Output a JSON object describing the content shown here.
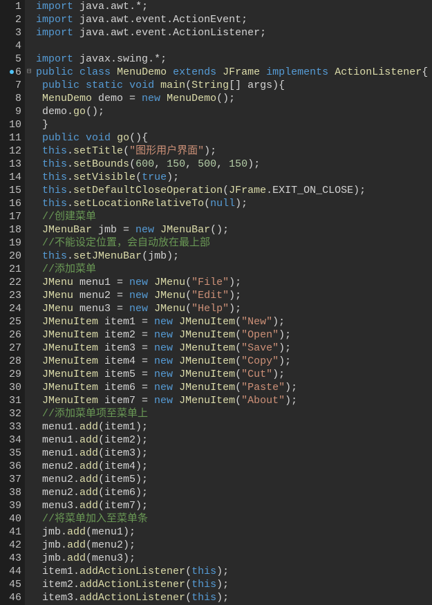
{
  "lines": [
    {
      "n": 1,
      "tokens": [
        [
          "kw",
          "import"
        ],
        [
          "txt",
          " java"
        ],
        [
          "txt",
          "."
        ],
        [
          "txt",
          "awt"
        ],
        [
          "txt",
          ".*;"
        ]
      ]
    },
    {
      "n": 2,
      "tokens": [
        [
          "kw",
          "import"
        ],
        [
          "txt",
          " java"
        ],
        [
          "txt",
          "."
        ],
        [
          "txt",
          "awt"
        ],
        [
          "txt",
          "."
        ],
        [
          "txt",
          "event"
        ],
        [
          "txt",
          "."
        ],
        [
          "txt",
          "ActionEvent"
        ],
        [
          "txt",
          ";"
        ]
      ]
    },
    {
      "n": 3,
      "tokens": [
        [
          "kw",
          "import"
        ],
        [
          "txt",
          " java"
        ],
        [
          "txt",
          "."
        ],
        [
          "txt",
          "awt"
        ],
        [
          "txt",
          "."
        ],
        [
          "txt",
          "event"
        ],
        [
          "txt",
          "."
        ],
        [
          "txt",
          "ActionListener"
        ],
        [
          "txt",
          ";"
        ]
      ]
    },
    {
      "n": 4,
      "tokens": []
    },
    {
      "n": 5,
      "tokens": [
        [
          "kw",
          "import"
        ],
        [
          "txt",
          " javax"
        ],
        [
          "txt",
          "."
        ],
        [
          "txt",
          "swing"
        ],
        [
          "txt",
          ".*;"
        ]
      ]
    },
    {
      "n": 6,
      "bp": true,
      "fold": true,
      "tokens": [
        [
          "kw",
          "public"
        ],
        [
          "txt",
          " "
        ],
        [
          "kw",
          "class"
        ],
        [
          "txt",
          " "
        ],
        [
          "cls",
          "MenuDemo"
        ],
        [
          "txt",
          " "
        ],
        [
          "kw",
          "extends"
        ],
        [
          "txt",
          " "
        ],
        [
          "cls",
          "JFrame"
        ],
        [
          "txt",
          " "
        ],
        [
          "kw",
          "implements"
        ],
        [
          "txt",
          " "
        ],
        [
          "cls",
          "ActionListener"
        ],
        [
          "txt",
          "{"
        ]
      ]
    },
    {
      "n": 7,
      "tokens": [
        [
          "txt",
          " "
        ],
        [
          "kw",
          "public"
        ],
        [
          "txt",
          " "
        ],
        [
          "kw",
          "static"
        ],
        [
          "txt",
          " "
        ],
        [
          "kw",
          "void"
        ],
        [
          "txt",
          " "
        ],
        [
          "cls",
          "main"
        ],
        [
          "txt",
          "("
        ],
        [
          "cls",
          "String"
        ],
        [
          "txt",
          "[] args){"
        ]
      ]
    },
    {
      "n": 8,
      "tokens": [
        [
          "txt",
          " "
        ],
        [
          "cls",
          "MenuDemo"
        ],
        [
          "txt",
          " demo = "
        ],
        [
          "kw",
          "new"
        ],
        [
          "txt",
          " "
        ],
        [
          "cls",
          "MenuDemo"
        ],
        [
          "txt",
          "();"
        ]
      ]
    },
    {
      "n": 9,
      "tokens": [
        [
          "txt",
          " demo"
        ],
        [
          "txt",
          "."
        ],
        [
          "cls",
          "go"
        ],
        [
          "txt",
          "();"
        ]
      ]
    },
    {
      "n": 10,
      "tokens": [
        [
          "txt",
          " }"
        ]
      ]
    },
    {
      "n": 11,
      "tokens": [
        [
          "txt",
          " "
        ],
        [
          "kw",
          "public"
        ],
        [
          "txt",
          " "
        ],
        [
          "kw",
          "void"
        ],
        [
          "txt",
          " "
        ],
        [
          "cls",
          "go"
        ],
        [
          "txt",
          "(){"
        ]
      ]
    },
    {
      "n": 12,
      "tokens": [
        [
          "txt",
          " "
        ],
        [
          "kw",
          "this"
        ],
        [
          "txt",
          "."
        ],
        [
          "cls",
          "setTitle"
        ],
        [
          "txt",
          "("
        ],
        [
          "str",
          "\"图形用户界面\""
        ],
        [
          "txt",
          ");"
        ]
      ]
    },
    {
      "n": 13,
      "tokens": [
        [
          "txt",
          " "
        ],
        [
          "kw",
          "this"
        ],
        [
          "txt",
          "."
        ],
        [
          "cls",
          "setBounds"
        ],
        [
          "txt",
          "("
        ],
        [
          "num",
          "600"
        ],
        [
          "txt",
          ", "
        ],
        [
          "num",
          "150"
        ],
        [
          "txt",
          ", "
        ],
        [
          "num",
          "500"
        ],
        [
          "txt",
          ", "
        ],
        [
          "num",
          "150"
        ],
        [
          "txt",
          ");"
        ]
      ]
    },
    {
      "n": 14,
      "tokens": [
        [
          "txt",
          " "
        ],
        [
          "kw",
          "this"
        ],
        [
          "txt",
          "."
        ],
        [
          "cls",
          "setVisible"
        ],
        [
          "txt",
          "("
        ],
        [
          "kw",
          "true"
        ],
        [
          "txt",
          ");"
        ]
      ]
    },
    {
      "n": 15,
      "tokens": [
        [
          "txt",
          " "
        ],
        [
          "kw",
          "this"
        ],
        [
          "txt",
          "."
        ],
        [
          "cls",
          "setDefaultCloseOperation"
        ],
        [
          "txt",
          "("
        ],
        [
          "cls",
          "JFrame"
        ],
        [
          "txt",
          "."
        ],
        [
          "txt",
          "EXIT_ON_CLOSE"
        ],
        [
          "txt",
          ");"
        ]
      ]
    },
    {
      "n": 16,
      "tokens": [
        [
          "txt",
          " "
        ],
        [
          "kw",
          "this"
        ],
        [
          "txt",
          "."
        ],
        [
          "cls",
          "setLocationRelativeTo"
        ],
        [
          "txt",
          "("
        ],
        [
          "kw",
          "null"
        ],
        [
          "txt",
          ");"
        ]
      ]
    },
    {
      "n": 17,
      "tokens": [
        [
          "txt",
          " "
        ],
        [
          "comment",
          "//创建菜单"
        ]
      ]
    },
    {
      "n": 18,
      "tokens": [
        [
          "txt",
          " "
        ],
        [
          "cls",
          "JMenuBar"
        ],
        [
          "txt",
          " jmb = "
        ],
        [
          "kw",
          "new"
        ],
        [
          "txt",
          " "
        ],
        [
          "cls",
          "JMenuBar"
        ],
        [
          "txt",
          "();"
        ]
      ]
    },
    {
      "n": 19,
      "tokens": [
        [
          "txt",
          " "
        ],
        [
          "comment",
          "//不能设定位置，会自动放在最上部"
        ]
      ]
    },
    {
      "n": 20,
      "tokens": [
        [
          "txt",
          " "
        ],
        [
          "kw",
          "this"
        ],
        [
          "txt",
          "."
        ],
        [
          "cls",
          "setJMenuBar"
        ],
        [
          "txt",
          "(jmb);"
        ]
      ]
    },
    {
      "n": 21,
      "tokens": [
        [
          "txt",
          " "
        ],
        [
          "comment",
          "//添加菜单"
        ]
      ]
    },
    {
      "n": 22,
      "tokens": [
        [
          "txt",
          " "
        ],
        [
          "cls",
          "JMenu"
        ],
        [
          "txt",
          " menu1 = "
        ],
        [
          "kw",
          "new"
        ],
        [
          "txt",
          " "
        ],
        [
          "cls",
          "JMenu"
        ],
        [
          "txt",
          "("
        ],
        [
          "str",
          "\"File\""
        ],
        [
          "txt",
          ");"
        ]
      ]
    },
    {
      "n": 23,
      "tokens": [
        [
          "txt",
          " "
        ],
        [
          "cls",
          "JMenu"
        ],
        [
          "txt",
          " menu2 = "
        ],
        [
          "kw",
          "new"
        ],
        [
          "txt",
          " "
        ],
        [
          "cls",
          "JMenu"
        ],
        [
          "txt",
          "("
        ],
        [
          "str",
          "\"Edit\""
        ],
        [
          "txt",
          ");"
        ]
      ]
    },
    {
      "n": 24,
      "tokens": [
        [
          "txt",
          " "
        ],
        [
          "cls",
          "JMenu"
        ],
        [
          "txt",
          " menu3 = "
        ],
        [
          "kw",
          "new"
        ],
        [
          "txt",
          " "
        ],
        [
          "cls",
          "JMenu"
        ],
        [
          "txt",
          "("
        ],
        [
          "str",
          "\"Help\""
        ],
        [
          "txt",
          ");"
        ]
      ]
    },
    {
      "n": 25,
      "tokens": [
        [
          "txt",
          " "
        ],
        [
          "cls",
          "JMenuItem"
        ],
        [
          "txt",
          " item1 = "
        ],
        [
          "kw",
          "new"
        ],
        [
          "txt",
          " "
        ],
        [
          "cls",
          "JMenuItem"
        ],
        [
          "txt",
          "("
        ],
        [
          "str",
          "\"New\""
        ],
        [
          "txt",
          ");"
        ]
      ]
    },
    {
      "n": 26,
      "tokens": [
        [
          "txt",
          " "
        ],
        [
          "cls",
          "JMenuItem"
        ],
        [
          "txt",
          " item2 = "
        ],
        [
          "kw",
          "new"
        ],
        [
          "txt",
          " "
        ],
        [
          "cls",
          "JMenuItem"
        ],
        [
          "txt",
          "("
        ],
        [
          "str",
          "\"Open\""
        ],
        [
          "txt",
          ");"
        ]
      ]
    },
    {
      "n": 27,
      "tokens": [
        [
          "txt",
          " "
        ],
        [
          "cls",
          "JMenuItem"
        ],
        [
          "txt",
          " item3 = "
        ],
        [
          "kw",
          "new"
        ],
        [
          "txt",
          " "
        ],
        [
          "cls",
          "JMenuItem"
        ],
        [
          "txt",
          "("
        ],
        [
          "str",
          "\"Save\""
        ],
        [
          "txt",
          ");"
        ]
      ]
    },
    {
      "n": 28,
      "tokens": [
        [
          "txt",
          " "
        ],
        [
          "cls",
          "JMenuItem"
        ],
        [
          "txt",
          " item4 = "
        ],
        [
          "kw",
          "new"
        ],
        [
          "txt",
          " "
        ],
        [
          "cls",
          "JMenuItem"
        ],
        [
          "txt",
          "("
        ],
        [
          "str",
          "\"Copy\""
        ],
        [
          "txt",
          ");"
        ]
      ]
    },
    {
      "n": 29,
      "tokens": [
        [
          "txt",
          " "
        ],
        [
          "cls",
          "JMenuItem"
        ],
        [
          "txt",
          " item5 = "
        ],
        [
          "kw",
          "new"
        ],
        [
          "txt",
          " "
        ],
        [
          "cls",
          "JMenuItem"
        ],
        [
          "txt",
          "("
        ],
        [
          "str",
          "\"Cut\""
        ],
        [
          "txt",
          ");"
        ]
      ]
    },
    {
      "n": 30,
      "tokens": [
        [
          "txt",
          " "
        ],
        [
          "cls",
          "JMenuItem"
        ],
        [
          "txt",
          " item6 = "
        ],
        [
          "kw",
          "new"
        ],
        [
          "txt",
          " "
        ],
        [
          "cls",
          "JMenuItem"
        ],
        [
          "txt",
          "("
        ],
        [
          "str",
          "\"Paste\""
        ],
        [
          "txt",
          ");"
        ]
      ]
    },
    {
      "n": 31,
      "tokens": [
        [
          "txt",
          " "
        ],
        [
          "cls",
          "JMenuItem"
        ],
        [
          "txt",
          " item7 = "
        ],
        [
          "kw",
          "new"
        ],
        [
          "txt",
          " "
        ],
        [
          "cls",
          "JMenuItem"
        ],
        [
          "txt",
          "("
        ],
        [
          "str",
          "\"About\""
        ],
        [
          "txt",
          ");"
        ]
      ]
    },
    {
      "n": 32,
      "tokens": [
        [
          "txt",
          " "
        ],
        [
          "comment",
          "//添加菜单项至菜单上"
        ]
      ]
    },
    {
      "n": 33,
      "tokens": [
        [
          "txt",
          " menu1"
        ],
        [
          "txt",
          "."
        ],
        [
          "cls",
          "add"
        ],
        [
          "txt",
          "(item1);"
        ]
      ]
    },
    {
      "n": 34,
      "tokens": [
        [
          "txt",
          " menu1"
        ],
        [
          "txt",
          "."
        ],
        [
          "cls",
          "add"
        ],
        [
          "txt",
          "(item2);"
        ]
      ]
    },
    {
      "n": 35,
      "tokens": [
        [
          "txt",
          " menu1"
        ],
        [
          "txt",
          "."
        ],
        [
          "cls",
          "add"
        ],
        [
          "txt",
          "(item3);"
        ]
      ]
    },
    {
      "n": 36,
      "tokens": [
        [
          "txt",
          " menu2"
        ],
        [
          "txt",
          "."
        ],
        [
          "cls",
          "add"
        ],
        [
          "txt",
          "(item4);"
        ]
      ]
    },
    {
      "n": 37,
      "tokens": [
        [
          "txt",
          " menu2"
        ],
        [
          "txt",
          "."
        ],
        [
          "cls",
          "add"
        ],
        [
          "txt",
          "(item5);"
        ]
      ]
    },
    {
      "n": 38,
      "tokens": [
        [
          "txt",
          " menu2"
        ],
        [
          "txt",
          "."
        ],
        [
          "cls",
          "add"
        ],
        [
          "txt",
          "(item6);"
        ]
      ]
    },
    {
      "n": 39,
      "tokens": [
        [
          "txt",
          " menu3"
        ],
        [
          "txt",
          "."
        ],
        [
          "cls",
          "add"
        ],
        [
          "txt",
          "(item7);"
        ]
      ]
    },
    {
      "n": 40,
      "tokens": [
        [
          "txt",
          " "
        ],
        [
          "comment",
          "//将菜单加入至菜单条"
        ]
      ]
    },
    {
      "n": 41,
      "tokens": [
        [
          "txt",
          " jmb"
        ],
        [
          "txt",
          "."
        ],
        [
          "cls",
          "add"
        ],
        [
          "txt",
          "(menu1);"
        ]
      ]
    },
    {
      "n": 42,
      "tokens": [
        [
          "txt",
          " jmb"
        ],
        [
          "txt",
          "."
        ],
        [
          "cls",
          "add"
        ],
        [
          "txt",
          "(menu2);"
        ]
      ]
    },
    {
      "n": 43,
      "tokens": [
        [
          "txt",
          " jmb"
        ],
        [
          "txt",
          "."
        ],
        [
          "cls",
          "add"
        ],
        [
          "txt",
          "(menu3);"
        ]
      ]
    },
    {
      "n": 44,
      "tokens": [
        [
          "txt",
          " item1"
        ],
        [
          "txt",
          "."
        ],
        [
          "cls",
          "addActionListener"
        ],
        [
          "txt",
          "("
        ],
        [
          "kw",
          "this"
        ],
        [
          "txt",
          ");"
        ]
      ]
    },
    {
      "n": 45,
      "tokens": [
        [
          "txt",
          " item2"
        ],
        [
          "txt",
          "."
        ],
        [
          "cls",
          "addActionListener"
        ],
        [
          "txt",
          "("
        ],
        [
          "kw",
          "this"
        ],
        [
          "txt",
          ");"
        ]
      ]
    },
    {
      "n": 46,
      "tokens": [
        [
          "txt",
          " item3"
        ],
        [
          "txt",
          "."
        ],
        [
          "cls",
          "addActionListener"
        ],
        [
          "txt",
          "("
        ],
        [
          "kw",
          "this"
        ],
        [
          "txt",
          ");"
        ]
      ]
    }
  ],
  "foldMarker": "⊟"
}
